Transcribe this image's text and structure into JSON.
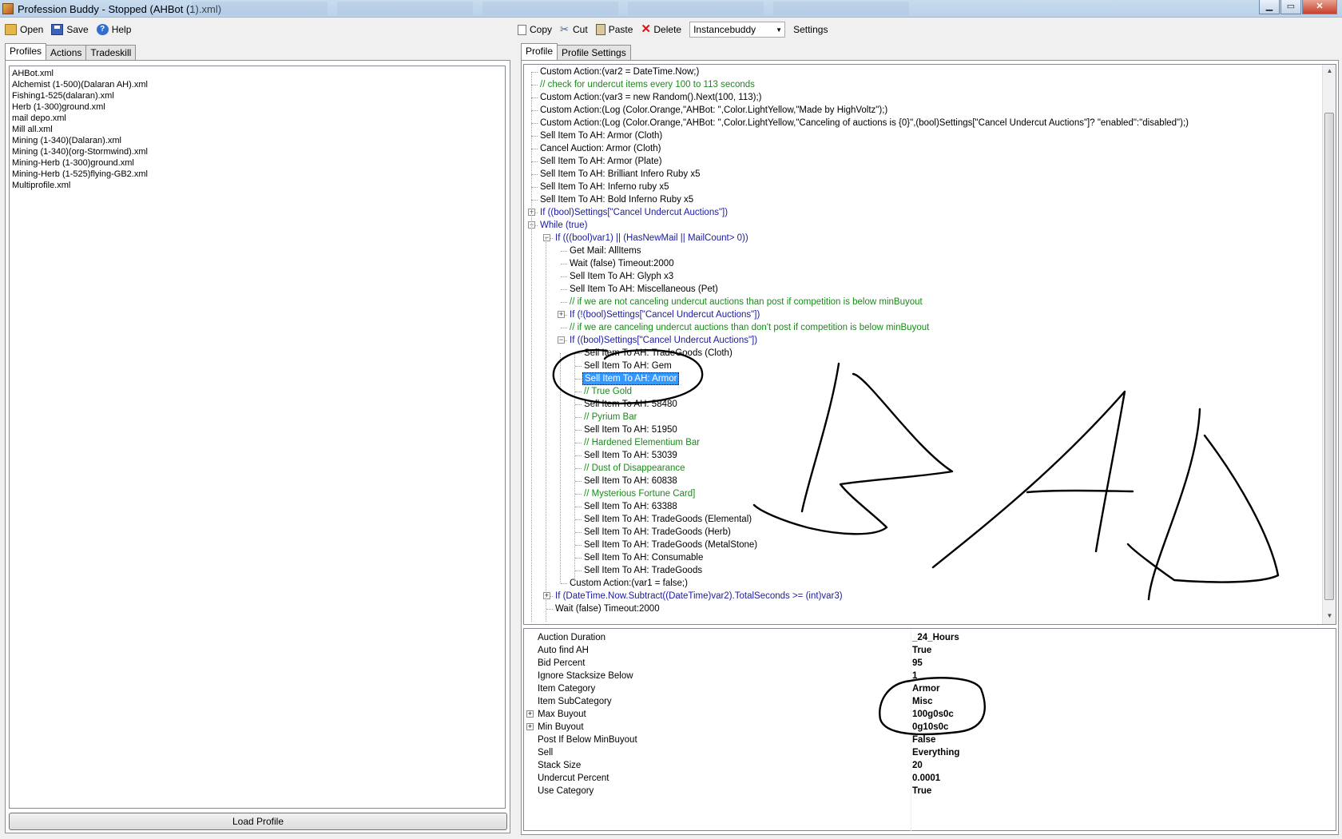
{
  "window": {
    "title": "Profession Buddy - Stopped (AHBot (1).xml)",
    "minimize": "▁",
    "maximize": "▭",
    "close": "✕"
  },
  "toolbar_left": {
    "open": "Open",
    "save": "Save",
    "help": "Help"
  },
  "toolbar_right": {
    "copy": "Copy",
    "cut": "Cut",
    "paste": "Paste",
    "delete": "Delete",
    "bot_select": "Instancebuddy",
    "settings": "Settings"
  },
  "left_tabs": [
    "Profiles",
    "Actions",
    "Tradeskill"
  ],
  "profiles": [
    "AHBot.xml",
    "Alchemist (1-500)(Dalaran AH).xml",
    "Fishing1-525(dalaran).xml",
    "Herb (1-300)ground.xml",
    "mail depo.xml",
    "Mill all.xml",
    "Mining (1-340)(Dalaran).xml",
    "Mining (1-340)(org-Stormwind).xml",
    "Mining-Herb (1-300)ground.xml",
    "Mining-Herb (1-525)flying-GB2.xml",
    "Multiprofile.xml"
  ],
  "load_button": "Load Profile",
  "right_tabs": [
    "Profile",
    "Profile Settings"
  ],
  "tree": [
    {
      "text": "Custom Action:(var2 = DateTime.Now;)",
      "level": 0,
      "type": "action"
    },
    {
      "text": "// check for undercut items every 100 to 113 seconds",
      "level": 0,
      "type": "comment"
    },
    {
      "text": "Custom Action:(var3 = new Random().Next(100, 113);)",
      "level": 0,
      "type": "action"
    },
    {
      "text": "Custom Action:(Log (Color.Orange,\"AHBot: \",Color.LightYellow,\"Made by HighVoltz\");)",
      "level": 0,
      "type": "action"
    },
    {
      "text": "Custom Action:(Log (Color.Orange,\"AHBot: \",Color.LightYellow,\"Canceling of auctions is {0}\",(bool)Settings[\"Cancel Undercut Auctions\"]? \"enabled\":\"disabled\");)",
      "level": 0,
      "type": "action"
    },
    {
      "text": "Sell Item To AH: Armor (Cloth)",
      "level": 0,
      "type": "action"
    },
    {
      "text": "Cancel Auction: Armor (Cloth)",
      "level": 0,
      "type": "action"
    },
    {
      "text": "Sell Item To AH: Armor (Plate)",
      "level": 0,
      "type": "action"
    },
    {
      "text": "Sell Item To AH: Brilliant Infero Ruby x5",
      "level": 0,
      "type": "action"
    },
    {
      "text": "Sell Item To AH: Inferno ruby x5",
      "level": 0,
      "type": "action"
    },
    {
      "text": "Sell Item To AH: Bold Inferno Ruby x5",
      "level": 0,
      "type": "action"
    },
    {
      "text": "If ((bool)Settings[\"Cancel Undercut Auctions\"])",
      "level": 0,
      "type": "flow",
      "expander": "+"
    },
    {
      "text": "While (true)",
      "level": 0,
      "type": "flow",
      "expander": "-"
    },
    {
      "text": "If (((bool)var1) || (HasNewMail || MailCount> 0))",
      "level": 1,
      "type": "flow",
      "expander": "-"
    },
    {
      "text": "Get Mail: AllItems",
      "level": 2,
      "type": "action"
    },
    {
      "text": "Wait (false) Timeout:2000",
      "level": 2,
      "type": "action"
    },
    {
      "text": "Sell Item To AH: Glyph  x3",
      "level": 2,
      "type": "action"
    },
    {
      "text": "Sell Item To AH: Miscellaneous (Pet)",
      "level": 2,
      "type": "action"
    },
    {
      "text": "// if we are not canceling undercut auctions than post if competition is below minBuyout",
      "level": 2,
      "type": "comment"
    },
    {
      "text": "If (!(bool)Settings[\"Cancel Undercut Auctions\"])",
      "level": 2,
      "type": "flow",
      "expander": "+"
    },
    {
      "text": "// if we are canceling undercut auctions than don't post if competition is below minBuyout",
      "level": 2,
      "type": "comment"
    },
    {
      "text": "If ((bool)Settings[\"Cancel Undercut Auctions\"])",
      "level": 2,
      "type": "flow",
      "expander": "-"
    },
    {
      "text": "Sell Item To AH: TradeGoods (Cloth)",
      "level": 3,
      "type": "action"
    },
    {
      "text": "Sell Item To AH: Gem",
      "level": 3,
      "type": "action"
    },
    {
      "text": "Sell Item To AH: Armor",
      "level": 3,
      "type": "action",
      "selected": true
    },
    {
      "text": "// True Gold",
      "level": 3,
      "type": "comment"
    },
    {
      "text": "Sell Item To AH: 58480",
      "level": 3,
      "type": "action"
    },
    {
      "text": "// Pyrium Bar",
      "level": 3,
      "type": "comment"
    },
    {
      "text": "Sell Item To AH: 51950",
      "level": 3,
      "type": "action"
    },
    {
      "text": "// Hardened Elementium Bar",
      "level": 3,
      "type": "comment"
    },
    {
      "text": "Sell Item To AH: 53039",
      "level": 3,
      "type": "action"
    },
    {
      "text": "// Dust of Disappearance",
      "level": 3,
      "type": "comment"
    },
    {
      "text": "Sell Item To AH: 60838",
      "level": 3,
      "type": "action"
    },
    {
      "text": "// Mysterious Fortune Card]",
      "level": 3,
      "type": "comment"
    },
    {
      "text": "Sell Item To AH: 63388",
      "level": 3,
      "type": "action"
    },
    {
      "text": "Sell Item To AH: TradeGoods (Elemental)",
      "level": 3,
      "type": "action"
    },
    {
      "text": "Sell Item To AH: TradeGoods (Herb)",
      "level": 3,
      "type": "action"
    },
    {
      "text": "Sell Item To AH: TradeGoods (MetalStone)",
      "level": 3,
      "type": "action"
    },
    {
      "text": "Sell Item To AH: Consumable",
      "level": 3,
      "type": "action"
    },
    {
      "text": "Sell Item To AH: TradeGoods",
      "level": 3,
      "type": "action"
    },
    {
      "text": "Custom Action:(var1 = false;)",
      "level": 2,
      "type": "action"
    },
    {
      "text": "If (DateTime.Now.Subtract((DateTime)var2).TotalSeconds >= (int)var3)",
      "level": 1,
      "type": "flow",
      "expander": "+"
    },
    {
      "text": "Wait (false) Timeout:2000",
      "level": 1,
      "type": "action"
    }
  ],
  "properties": [
    {
      "name": "Auction Duration",
      "value": "_24_Hours"
    },
    {
      "name": "Auto find AH",
      "value": "True"
    },
    {
      "name": "Bid Percent",
      "value": "95"
    },
    {
      "name": "Ignore Stacksize Below",
      "value": "1"
    },
    {
      "name": "Item Category",
      "value": "Armor"
    },
    {
      "name": "Item SubCategory",
      "value": "Misc"
    },
    {
      "name": "Max Buyout",
      "value": "100g0s0c",
      "expander": "+"
    },
    {
      "name": "Min Buyout",
      "value": "0g10s0c",
      "expander": "+"
    },
    {
      "name": "Post If Below MinBuyout",
      "value": "False"
    },
    {
      "name": "Sell",
      "value": "Everything"
    },
    {
      "name": "Stack Size",
      "value": "20"
    },
    {
      "name": "Undercut Percent",
      "value": "0.0001"
    },
    {
      "name": "Use Category",
      "value": "True"
    }
  ],
  "colors": {
    "comment": "#1a8a1a",
    "flow": "#1a1aa0",
    "selection": "#3399ff",
    "ink": "#000000"
  }
}
